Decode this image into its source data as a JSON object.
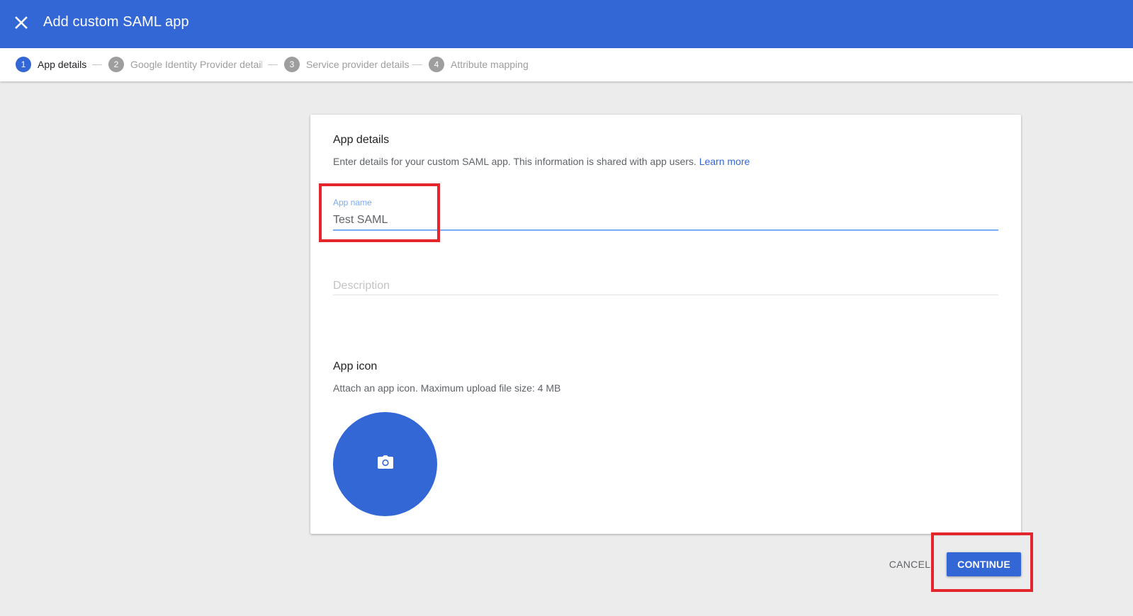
{
  "header": {
    "title": "Add custom SAML app",
    "close_icon": "close-icon",
    "background_color": "#3367d6"
  },
  "stepper": {
    "steps": [
      {
        "number": "1",
        "label": "App details",
        "active": true
      },
      {
        "number": "2",
        "label": "Google Identity Provider detail:",
        "active": false
      },
      {
        "number": "3",
        "label": "Service provider details",
        "active": false
      },
      {
        "number": "4",
        "label": "Attribute mapping",
        "active": false
      }
    ]
  },
  "app_details": {
    "title": "App details",
    "description": "Enter details for your custom SAML app. This information is shared with app users.",
    "learn_more": "Learn more",
    "app_name": {
      "label": "App name",
      "value": "Test SAML"
    },
    "description_field": {
      "placeholder": "Description",
      "value": ""
    }
  },
  "app_icon": {
    "title": "App icon",
    "description": "Attach an app icon. Maximum upload file size: 4 MB",
    "icon": "camera-icon"
  },
  "actions": {
    "cancel": "CANCEL",
    "continue": "CONTINUE"
  },
  "colors": {
    "accent": "#3367d6",
    "highlight": "#e3262b"
  }
}
